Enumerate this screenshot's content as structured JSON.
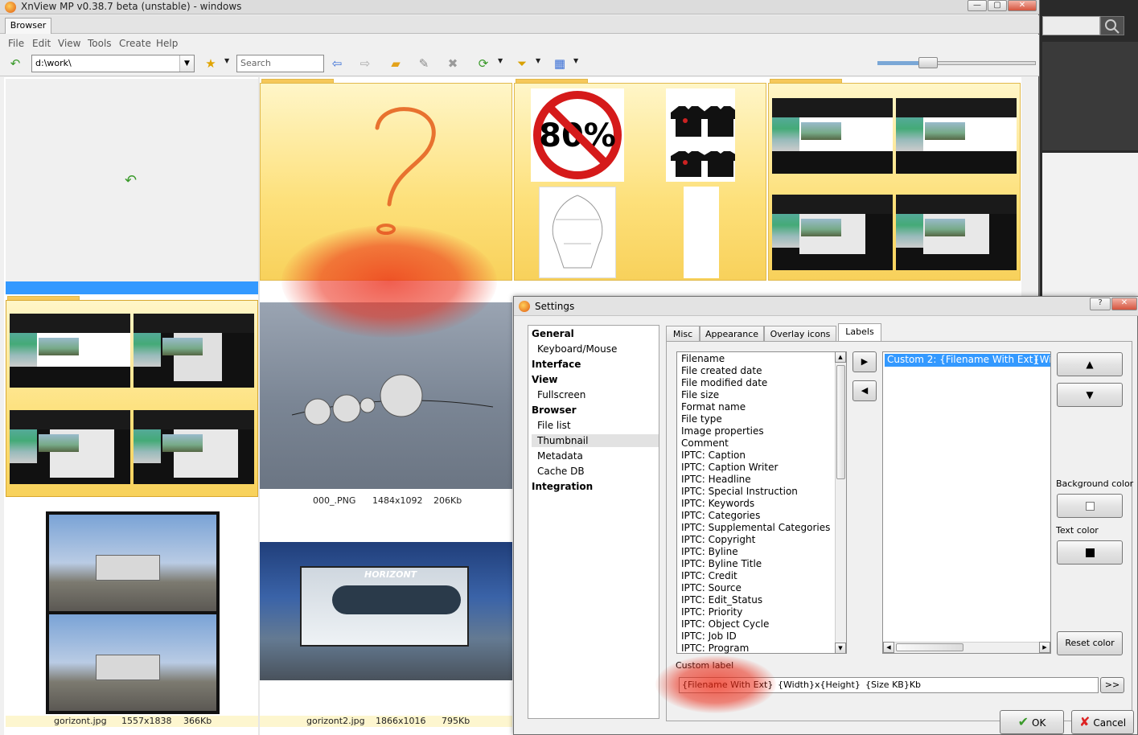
{
  "window": {
    "title": "XnView MP v0.38.7 beta (unstable) - windows",
    "minimize": "—",
    "maximize": "▢",
    "close": "✕"
  },
  "tabs": {
    "browser": "Browser"
  },
  "menu": [
    "File",
    "Edit",
    "View",
    "Tools",
    "Create",
    "Help"
  ],
  "toolbar": {
    "path": "d:\\work\\",
    "search_placeholder": "Search"
  },
  "thumbs": {
    "png": {
      "name": "000_.PNG",
      "dims": "1484x1092",
      "size": "206Kb"
    },
    "gorizont": {
      "name": "gorizont.jpg",
      "dims": "1557x1838",
      "size": "366Kb"
    },
    "gorizont2": {
      "name": "gorizont2.jpg",
      "dims": "1866x1016",
      "size": "795Kb"
    },
    "no_sign_text": "80%",
    "building_sign": "HORIZONT"
  },
  "settings": {
    "title": "Settings",
    "help_btn": "?",
    "close_btn": "✕",
    "tree": [
      {
        "label": "General",
        "bold": true
      },
      {
        "label": "Keyboard/Mouse",
        "bold": false
      },
      {
        "label": "Interface",
        "bold": true
      },
      {
        "label": "View",
        "bold": true
      },
      {
        "label": "Fullscreen",
        "bold": false
      },
      {
        "label": "Browser",
        "bold": true
      },
      {
        "label": "File list",
        "bold": false
      },
      {
        "label": "Thumbnail",
        "bold": false,
        "selected": true
      },
      {
        "label": "Metadata",
        "bold": false
      },
      {
        "label": "Cache DB",
        "bold": false
      },
      {
        "label": "Integration",
        "bold": true
      }
    ],
    "tabs": [
      "Misc",
      "Appearance",
      "Overlay icons",
      "Labels"
    ],
    "active_tab": "Labels",
    "available_fields": [
      "Filename",
      "File created date",
      "File modified date",
      "File size",
      "Format name",
      "File type",
      "Image properties",
      "Comment",
      "IPTC: Caption",
      "IPTC: Caption Writer",
      "IPTC: Headline",
      "IPTC: Special Instruction",
      "IPTC: Keywords",
      "IPTC: Categories",
      "IPTC: Supplemental Categories",
      "IPTC: Copyright",
      "IPTC: Byline",
      "IPTC: Byline Title",
      "IPTC: Credit",
      "IPTC: Source",
      "IPTC: Edit_Status",
      "IPTC: Priority",
      "IPTC: Object Cycle",
      "IPTC: Job ID",
      "IPTC: Program"
    ],
    "selected_fields": [
      {
        "label": "Custom 2: {Filename With Ext}",
        "extra": "{Wic"
      }
    ],
    "add_btn": "▶",
    "remove_btn": "◀",
    "up_btn": "▲",
    "down_btn": "▼",
    "background_color_label": "Background color",
    "text_color_label": "Text color",
    "reset_color": "Reset color",
    "custom_label_title": "Custom label",
    "custom_label_value": {
      "part1": "{Filename With Ext}",
      "part2": "{Width}x{Height}",
      "part3": "{Size KB}Kb"
    },
    "more_btn": ">>",
    "ok": "OK",
    "cancel": "Cancel",
    "colors": {
      "accent": "#3399ff",
      "selection": "#3399ff"
    }
  }
}
